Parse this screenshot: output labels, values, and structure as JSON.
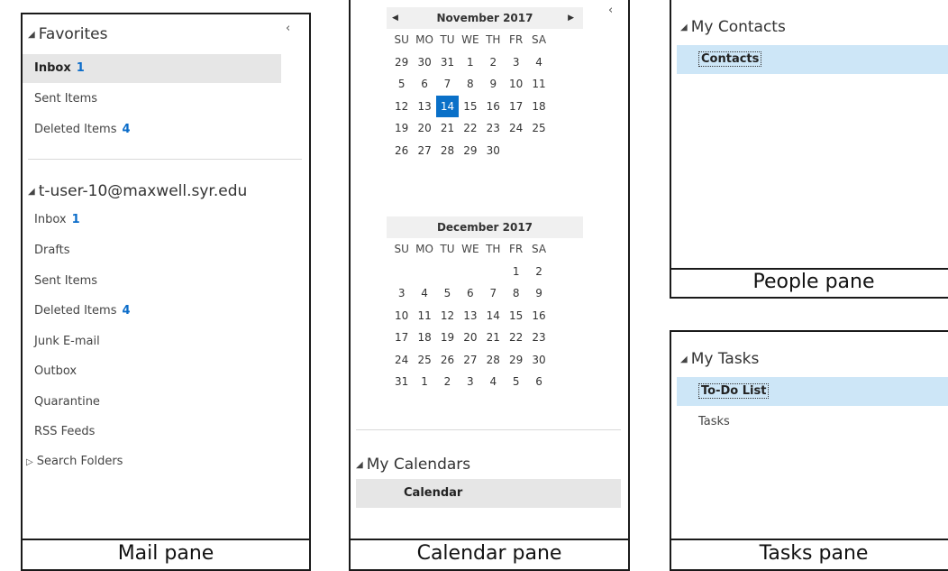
{
  "mail": {
    "label": "Mail pane",
    "collapse_glyph": "‹",
    "favorites_heading": "Favorites",
    "favorites": [
      {
        "name": "Inbox",
        "count": "1",
        "selected": true
      },
      {
        "name": "Sent Items",
        "count": ""
      },
      {
        "name": "Deleted Items",
        "count": "4"
      }
    ],
    "account_heading": "t-user-10@maxwell.syr.edu",
    "folders": [
      {
        "name": "Inbox",
        "count": "1"
      },
      {
        "name": "Drafts",
        "count": ""
      },
      {
        "name": "Sent Items",
        "count": ""
      },
      {
        "name": "Deleted Items",
        "count": "4"
      },
      {
        "name": "Junk E-mail",
        "count": ""
      },
      {
        "name": "Outbox",
        "count": ""
      },
      {
        "name": "Quarantine",
        "count": ""
      },
      {
        "name": "RSS Feeds",
        "count": ""
      }
    ],
    "search_folders": "Search Folders"
  },
  "calendar": {
    "label": "Calendar pane",
    "collapse_glyph": "‹",
    "prev_glyph": "◀",
    "next_glyph": "▶",
    "dow": [
      "SU",
      "MO",
      "TU",
      "WE",
      "TH",
      "FR",
      "SA"
    ],
    "months": [
      {
        "title": "November 2017",
        "days": [
          "29",
          "30",
          "31",
          "1",
          "2",
          "3",
          "4",
          "5",
          "6",
          "7",
          "8",
          "9",
          "10",
          "11",
          "12",
          "13",
          "14",
          "15",
          "16",
          "17",
          "18",
          "19",
          "20",
          "21",
          "22",
          "23",
          "24",
          "25",
          "26",
          "27",
          "28",
          "29",
          "30",
          "",
          "",
          "",
          "",
          "",
          "",
          "",
          "",
          ""
        ],
        "today_index": 16
      },
      {
        "title": "December 2017",
        "days": [
          "",
          "",
          "",
          "",
          "",
          "1",
          "2",
          "3",
          "4",
          "5",
          "6",
          "7",
          "8",
          "9",
          "10",
          "11",
          "12",
          "13",
          "14",
          "15",
          "16",
          "17",
          "18",
          "19",
          "20",
          "21",
          "22",
          "23",
          "24",
          "25",
          "26",
          "27",
          "28",
          "29",
          "30",
          "31",
          "1",
          "2",
          "3",
          "4",
          "5",
          "6"
        ],
        "today_index": -1
      }
    ],
    "my_calendars_heading": "My Calendars",
    "calendar_item": "Calendar"
  },
  "people": {
    "label": "People pane",
    "heading": "My Contacts",
    "item": "Contacts"
  },
  "tasks": {
    "label": "Tasks pane",
    "heading": "My Tasks",
    "items": [
      "To-Do List",
      "Tasks"
    ]
  },
  "colors": {
    "accent": "#0a70c8",
    "count": "#0b6cc9",
    "selected_gray": "#e6e6e6",
    "selected_blue": "#cde6f7"
  }
}
